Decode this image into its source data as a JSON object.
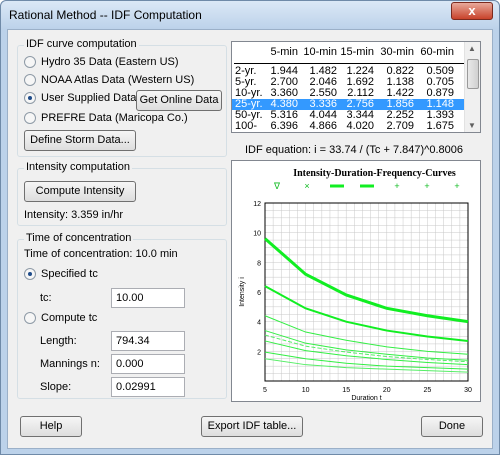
{
  "window": {
    "title": "Rational Method -- IDF Computation",
    "close": "x"
  },
  "idf": {
    "group_label": "IDF curve computation",
    "options": [
      "Hydro 35 Data (Eastern US)",
      "NOAA Atlas Data (Western US)",
      "User Supplied Data",
      "PREFRE Data (Maricopa Co.)"
    ],
    "selected": "User Supplied Data",
    "get_online": "Get Online Data",
    "define_storm": "Define Storm Data..."
  },
  "intensity": {
    "group_label": "Intensity computation",
    "compute_button": "Compute Intensity",
    "result": "Intensity:  3.359 in/hr"
  },
  "tc": {
    "group_label": "Time of concentration",
    "summary": "Time of concentration:  10.0 min",
    "specified_label": "Specified tc",
    "tc_label": "tc:",
    "tc_value": "10.00",
    "compute_label": "Compute tc",
    "length_label": "Length:",
    "length_value": "794.34",
    "mannings_label": "Mannings n:",
    "mannings_value": "0.000",
    "slope_label": "Slope:",
    "slope_value": "0.02991"
  },
  "table": {
    "headers": [
      "5-min",
      "10-min",
      "15-min",
      "30-min",
      "60-min"
    ],
    "rows": [
      {
        "label": "2-yr.",
        "values": [
          "1.944",
          "1.482",
          "1.224",
          "0.822",
          "0.509"
        ]
      },
      {
        "label": "5-yr.",
        "values": [
          "2.700",
          "2.046",
          "1.692",
          "1.138",
          "0.705"
        ]
      },
      {
        "label": "10-yr.",
        "values": [
          "3.360",
          "2.550",
          "2.112",
          "1.422",
          "0.879"
        ]
      },
      {
        "label": "25-yr.",
        "values": [
          "4.380",
          "3.336",
          "2.756",
          "1.856",
          "1.148"
        ]
      },
      {
        "label": "50-yr.",
        "values": [
          "5.316",
          "4.044",
          "3.344",
          "2.252",
          "1.393"
        ]
      },
      {
        "label": "100-yr.",
        "values": [
          "6.396",
          "4.866",
          "4.020",
          "2.709",
          "1.675"
        ]
      }
    ],
    "selected_row": "25-yr."
  },
  "equation": "IDF equation: i = 33.74 / (Tc + 7.847)^0.8006",
  "chart_data": {
    "type": "line",
    "title": "Intensity-Duration-Frequency-Curves",
    "xlabel": "Duration t",
    "ylabel": "Intensity i",
    "xlim": [
      5,
      30
    ],
    "ylim": [
      0,
      12
    ],
    "x_ticks": [
      5,
      10,
      15,
      20,
      25,
      30
    ],
    "y_ticks": [
      2,
      4,
      6,
      8,
      10,
      12
    ],
    "grid": true,
    "legend_markers": [
      "∇",
      "×",
      "",
      "",
      "+",
      "+",
      "+"
    ],
    "x": [
      5,
      10,
      15,
      20,
      25,
      30
    ],
    "series": [
      {
        "values": [
          9.6,
          7.2,
          5.8,
          4.9,
          4.4,
          4.0
        ],
        "color": "#11ee22",
        "width": 3
      },
      {
        "values": [
          6.4,
          4.9,
          4.0,
          3.4,
          3.0,
          2.7
        ],
        "color": "#11ee22",
        "width": 2
      },
      {
        "values": [
          4.4,
          3.3,
          2.75,
          2.3,
          2.0,
          1.8
        ],
        "color": "#33ee44",
        "width": 1
      },
      {
        "values": [
          3.4,
          2.55,
          2.1,
          1.8,
          1.55,
          1.4
        ],
        "color": "#33ee44",
        "width": 1
      },
      {
        "values": [
          3.1,
          2.35,
          1.95,
          1.65,
          1.45,
          1.3
        ],
        "color": "#55ee66",
        "width": 1,
        "dash": true
      },
      {
        "values": [
          2.7,
          2.05,
          1.7,
          1.45,
          1.25,
          1.1
        ],
        "color": "#33ee44",
        "width": 1
      },
      {
        "values": [
          1.95,
          1.5,
          1.2,
          1.0,
          0.9,
          0.8
        ],
        "color": "#33ee44",
        "width": 1
      },
      {
        "values": [
          1.5,
          1.1,
          0.9,
          0.8,
          0.7,
          0.6
        ],
        "color": "#55ee66",
        "width": 1
      }
    ]
  },
  "footer": {
    "help": "Help",
    "export": "Export IDF table...",
    "done": "Done"
  }
}
